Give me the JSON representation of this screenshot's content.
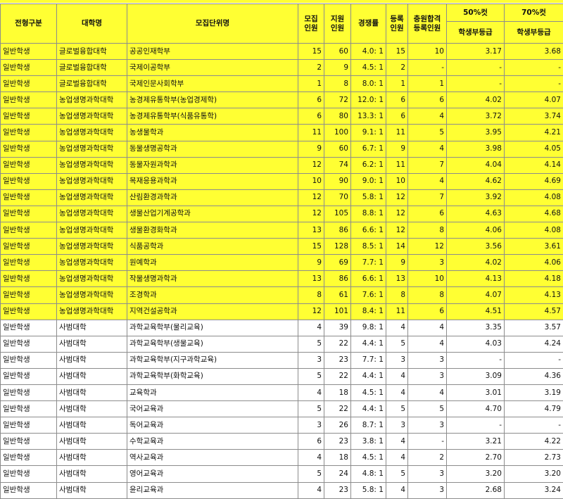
{
  "headers": {
    "type": "전형구분",
    "college": "대학명",
    "unit": "모집단위명",
    "recruit_l1": "모집",
    "recruit_l2": "인원",
    "apply_l1": "지원",
    "apply_l2": "인원",
    "ratio": "경쟁률",
    "reg_l1": "등록",
    "reg_l2": "인원",
    "add_l1": "충원합격",
    "add_l2": "등록인원",
    "cut50": "50%컷",
    "cut70": "70%컷",
    "grade": "학생부등급"
  },
  "rows": [
    {
      "hl": true,
      "type": "일반학생",
      "college": "글로벌융합대학",
      "unit": "공공인재학부",
      "recruit": "15",
      "apply": "60",
      "ratio": "4.0: 1",
      "reg": "15",
      "add": "10",
      "g50": "3.17",
      "g70": "3.68"
    },
    {
      "hl": true,
      "type": "일반학생",
      "college": "글로벌융합대학",
      "unit": "국제이공학부",
      "recruit": "2",
      "apply": "9",
      "ratio": "4.5: 1",
      "reg": "2",
      "add": "-",
      "g50": "-",
      "g70": "-"
    },
    {
      "hl": true,
      "type": "일반학생",
      "college": "글로벌융합대학",
      "unit": "국제인문사회학부",
      "recruit": "1",
      "apply": "8",
      "ratio": "8.0: 1",
      "reg": "1",
      "add": "1",
      "g50": "-",
      "g70": "-"
    },
    {
      "hl": true,
      "type": "일반학생",
      "college": "농업생명과학대학",
      "unit": "농경제유통학부(농업경제학)",
      "recruit": "6",
      "apply": "72",
      "ratio": "12.0: 1",
      "reg": "6",
      "add": "6",
      "g50": "4.02",
      "g70": "4.07"
    },
    {
      "hl": true,
      "type": "일반학생",
      "college": "농업생명과학대학",
      "unit": "농경제유통학부(식품유통학)",
      "recruit": "6",
      "apply": "80",
      "ratio": "13.3: 1",
      "reg": "6",
      "add": "4",
      "g50": "3.72",
      "g70": "3.74"
    },
    {
      "hl": true,
      "type": "일반학생",
      "college": "농업생명과학대학",
      "unit": "농생물학과",
      "recruit": "11",
      "apply": "100",
      "ratio": "9.1: 1",
      "reg": "11",
      "add": "5",
      "g50": "3.95",
      "g70": "4.21"
    },
    {
      "hl": true,
      "type": "일반학생",
      "college": "농업생명과학대학",
      "unit": "동물생명공학과",
      "recruit": "9",
      "apply": "60",
      "ratio": "6.7: 1",
      "reg": "9",
      "add": "4",
      "g50": "3.98",
      "g70": "4.05"
    },
    {
      "hl": true,
      "type": "일반학생",
      "college": "농업생명과학대학",
      "unit": "동물자원과학과",
      "recruit": "12",
      "apply": "74",
      "ratio": "6.2: 1",
      "reg": "11",
      "add": "7",
      "g50": "4.04",
      "g70": "4.14"
    },
    {
      "hl": true,
      "type": "일반학생",
      "college": "농업생명과학대학",
      "unit": "목재응용과학과",
      "recruit": "10",
      "apply": "90",
      "ratio": "9.0: 1",
      "reg": "10",
      "add": "4",
      "g50": "4.62",
      "g70": "4.69"
    },
    {
      "hl": true,
      "type": "일반학생",
      "college": "농업생명과학대학",
      "unit": "산림환경과학과",
      "recruit": "12",
      "apply": "70",
      "ratio": "5.8: 1",
      "reg": "12",
      "add": "7",
      "g50": "3.92",
      "g70": "4.08"
    },
    {
      "hl": true,
      "type": "일반학생",
      "college": "농업생명과학대학",
      "unit": "생물산업기계공학과",
      "recruit": "12",
      "apply": "105",
      "ratio": "8.8: 1",
      "reg": "12",
      "add": "6",
      "g50": "4.63",
      "g70": "4.68"
    },
    {
      "hl": true,
      "type": "일반학생",
      "college": "농업생명과학대학",
      "unit": "생물환경화학과",
      "recruit": "13",
      "apply": "86",
      "ratio": "6.6: 1",
      "reg": "12",
      "add": "8",
      "g50": "4.06",
      "g70": "4.08"
    },
    {
      "hl": true,
      "type": "일반학생",
      "college": "농업생명과학대학",
      "unit": "식품공학과",
      "recruit": "15",
      "apply": "128",
      "ratio": "8.5: 1",
      "reg": "14",
      "add": "12",
      "g50": "3.56",
      "g70": "3.61"
    },
    {
      "hl": true,
      "type": "일반학생",
      "college": "농업생명과학대학",
      "unit": "원예학과",
      "recruit": "9",
      "apply": "69",
      "ratio": "7.7: 1",
      "reg": "9",
      "add": "3",
      "g50": "4.02",
      "g70": "4.06"
    },
    {
      "hl": true,
      "type": "일반학생",
      "college": "농업생명과학대학",
      "unit": "작물생명과학과",
      "recruit": "13",
      "apply": "86",
      "ratio": "6.6: 1",
      "reg": "13",
      "add": "10",
      "g50": "4.13",
      "g70": "4.18"
    },
    {
      "hl": true,
      "type": "일반학생",
      "college": "농업생명과학대학",
      "unit": "조경학과",
      "recruit": "8",
      "apply": "61",
      "ratio": "7.6: 1",
      "reg": "8",
      "add": "8",
      "g50": "4.07",
      "g70": "4.13"
    },
    {
      "hl": true,
      "type": "일반학생",
      "college": "농업생명과학대학",
      "unit": "지역건설공학과",
      "recruit": "12",
      "apply": "101",
      "ratio": "8.4: 1",
      "reg": "11",
      "add": "6",
      "g50": "4.51",
      "g70": "4.57"
    },
    {
      "hl": false,
      "type": "일반학생",
      "college": "사범대학",
      "unit": "과학교육학부(물리교육)",
      "recruit": "4",
      "apply": "39",
      "ratio": "9.8: 1",
      "reg": "4",
      "add": "4",
      "g50": "3.35",
      "g70": "3.57"
    },
    {
      "hl": false,
      "type": "일반학생",
      "college": "사범대학",
      "unit": "과학교육학부(생물교육)",
      "recruit": "5",
      "apply": "22",
      "ratio": "4.4: 1",
      "reg": "5",
      "add": "4",
      "g50": "4.03",
      "g70": "4.24"
    },
    {
      "hl": false,
      "type": "일반학생",
      "college": "사범대학",
      "unit": "과학교육학부(지구과학교육)",
      "recruit": "3",
      "apply": "23",
      "ratio": "7.7: 1",
      "reg": "3",
      "add": "3",
      "g50": "-",
      "g70": "-"
    },
    {
      "hl": false,
      "type": "일반학생",
      "college": "사범대학",
      "unit": "과학교육학부(화학교육)",
      "recruit": "5",
      "apply": "22",
      "ratio": "4.4: 1",
      "reg": "4",
      "add": "3",
      "g50": "3.09",
      "g70": "4.36"
    },
    {
      "hl": false,
      "type": "일반학생",
      "college": "사범대학",
      "unit": "교육학과",
      "recruit": "4",
      "apply": "18",
      "ratio": "4.5: 1",
      "reg": "4",
      "add": "4",
      "g50": "3.01",
      "g70": "3.19"
    },
    {
      "hl": false,
      "type": "일반학생",
      "college": "사범대학",
      "unit": "국어교육과",
      "recruit": "5",
      "apply": "22",
      "ratio": "4.4: 1",
      "reg": "5",
      "add": "5",
      "g50": "4.70",
      "g70": "4.79"
    },
    {
      "hl": false,
      "type": "일반학생",
      "college": "사범대학",
      "unit": "독어교육과",
      "recruit": "3",
      "apply": "26",
      "ratio": "8.7: 1",
      "reg": "3",
      "add": "3",
      "g50": "-",
      "g70": "-"
    },
    {
      "hl": false,
      "type": "일반학생",
      "college": "사범대학",
      "unit": "수학교육과",
      "recruit": "6",
      "apply": "23",
      "ratio": "3.8: 1",
      "reg": "4",
      "add": "-",
      "g50": "3.21",
      "g70": "4.22"
    },
    {
      "hl": false,
      "type": "일반학생",
      "college": "사범대학",
      "unit": "역사교육과",
      "recruit": "4",
      "apply": "18",
      "ratio": "4.5: 1",
      "reg": "4",
      "add": "2",
      "g50": "2.70",
      "g70": "2.73"
    },
    {
      "hl": false,
      "type": "일반학생",
      "college": "사범대학",
      "unit": "영어교육과",
      "recruit": "5",
      "apply": "24",
      "ratio": "4.8: 1",
      "reg": "5",
      "add": "3",
      "g50": "3.20",
      "g70": "3.20"
    },
    {
      "hl": false,
      "type": "일반학생",
      "college": "사범대학",
      "unit": "윤리교육과",
      "recruit": "4",
      "apply": "23",
      "ratio": "5.8: 1",
      "reg": "4",
      "add": "3",
      "g50": "2.68",
      "g70": "3.24"
    }
  ]
}
